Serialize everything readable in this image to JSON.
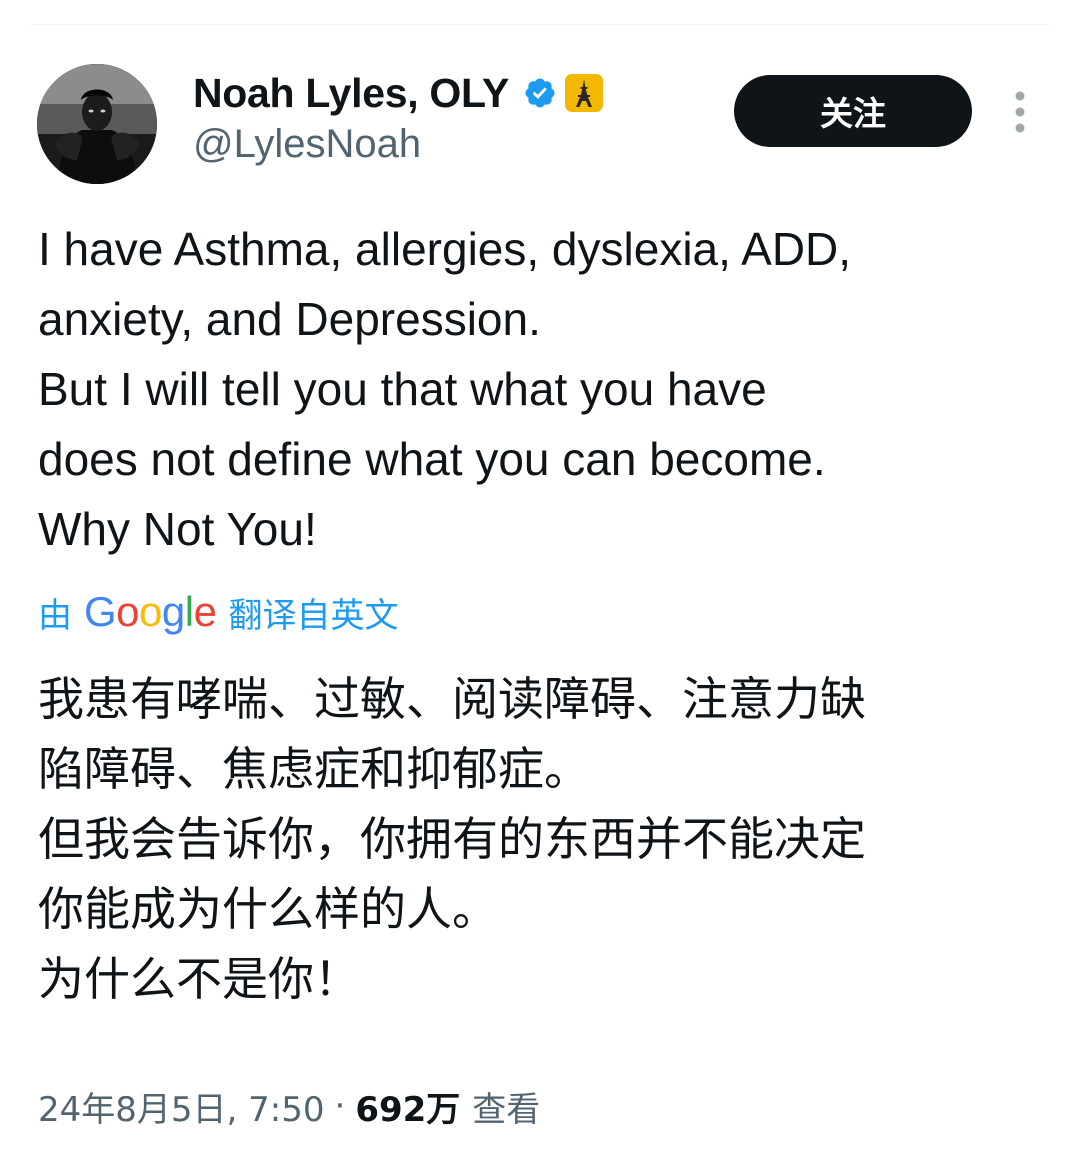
{
  "author": {
    "display_name": "Noah Lyles, OLY",
    "handle": "@LylesNoah",
    "verified": true,
    "badges": [
      "verified-badge-icon",
      "eiffel-tower-icon"
    ]
  },
  "follow_button": {
    "label": "关注"
  },
  "tweet": {
    "lines": [
      "I have Asthma, allergies, dyslexia, ADD,",
      "anxiety, and Depression.",
      "But I will tell you that what you have",
      "does not define what you can become.",
      "Why Not You!"
    ]
  },
  "translation": {
    "prefix": "由",
    "provider": "Google",
    "suffix": "翻译自英文",
    "lines": [
      "我患有哮喘、过敏、阅读障碍、注意力缺",
      "陷障碍、焦虑症和抑郁症。",
      "但我会告诉你，你拥有的东西并不能决定",
      "你能成为什么样的人。",
      "为什么不是你！"
    ]
  },
  "meta": {
    "timestamp": "24年8月5日, 7:50",
    "separator": "·",
    "views_count": "692万",
    "views_label": "查看"
  },
  "colors": {
    "text": "#0f1419",
    "secondary": "#536471",
    "link": "#1d9bf0",
    "verified": "#1d9bf0",
    "follow_bg": "#0f1419",
    "olympic_badge": "#f5b800"
  }
}
